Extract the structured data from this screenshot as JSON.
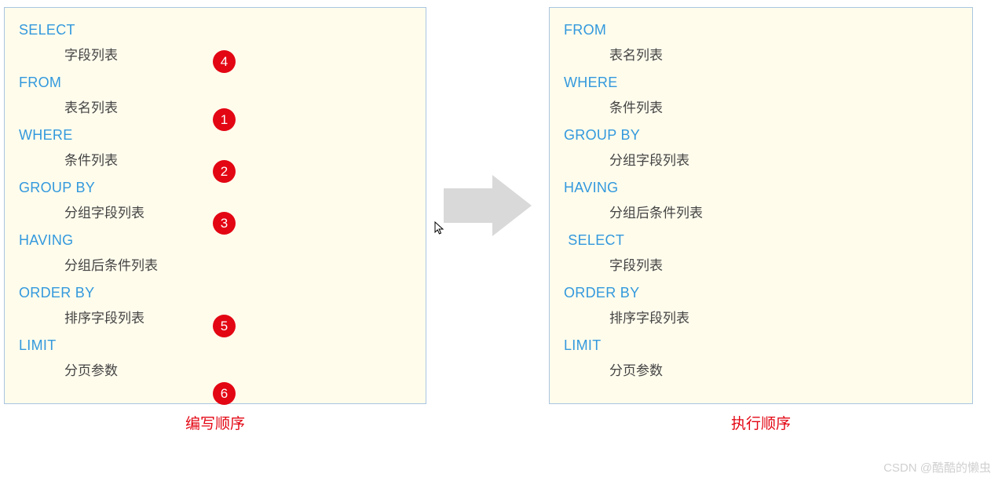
{
  "left": {
    "title": "编写顺序",
    "clauses": [
      {
        "keyword": "SELECT",
        "desc": "字段列表",
        "badge": "4"
      },
      {
        "keyword": "FROM",
        "desc": "表名列表",
        "badge": "1"
      },
      {
        "keyword": "WHERE",
        "desc": "条件列表",
        "badge": "2"
      },
      {
        "keyword": "GROUP  BY",
        "desc": "分组字段列表",
        "badge": "3"
      },
      {
        "keyword": "HAVING",
        "desc": "分组后条件列表",
        "badge": ""
      },
      {
        "keyword": "ORDER BY",
        "desc": "排序字段列表",
        "badge": "5"
      },
      {
        "keyword": "LIMIT",
        "desc": "分页参数",
        "badge": "6"
      }
    ]
  },
  "right": {
    "title": "执行顺序",
    "clauses": [
      {
        "keyword": "FROM",
        "desc": "表名列表"
      },
      {
        "keyword": "WHERE",
        "desc": "条件列表"
      },
      {
        "keyword": "GROUP  BY",
        "desc": "分组字段列表"
      },
      {
        "keyword": "HAVING",
        "desc": "分组后条件列表"
      },
      {
        "keyword": " SELECT",
        "desc": "字段列表"
      },
      {
        "keyword": "ORDER BY",
        "desc": "排序字段列表"
      },
      {
        "keyword": "LIMIT",
        "desc": "分页参数"
      }
    ]
  },
  "badge_positions": [
    54,
    128,
    194,
    260,
    391,
    477
  ],
  "watermark": "CSDN @酷酷的懒虫"
}
